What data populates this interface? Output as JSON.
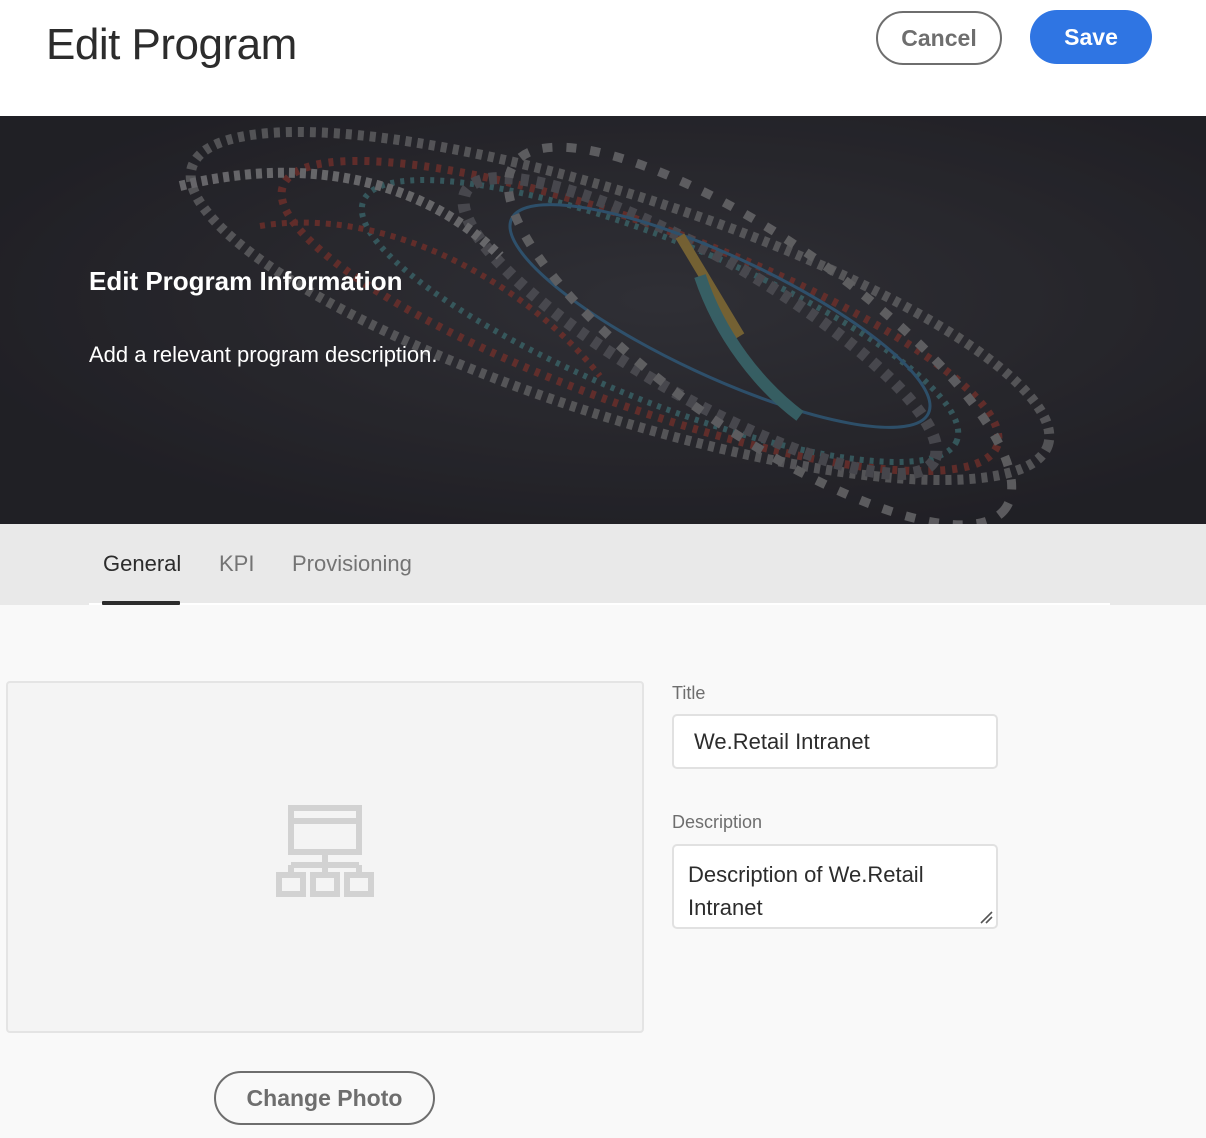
{
  "header": {
    "title": "Edit Program",
    "cancel_label": "Cancel",
    "save_label": "Save",
    "save_color": "#2f75e3"
  },
  "hero": {
    "title": "Edit Program Information",
    "subtitle": "Add a relevant program description."
  },
  "tabs": [
    {
      "label": "General",
      "active": true
    },
    {
      "label": "KPI",
      "active": false
    },
    {
      "label": "Provisioning",
      "active": false
    }
  ],
  "photo": {
    "icon": "site-structure-icon",
    "change_label": "Change Photo"
  },
  "form": {
    "title_label": "Title",
    "title_value": "We.Retail Intranet",
    "description_label": "Description",
    "description_value": "Description of We.Retail Intranet"
  }
}
